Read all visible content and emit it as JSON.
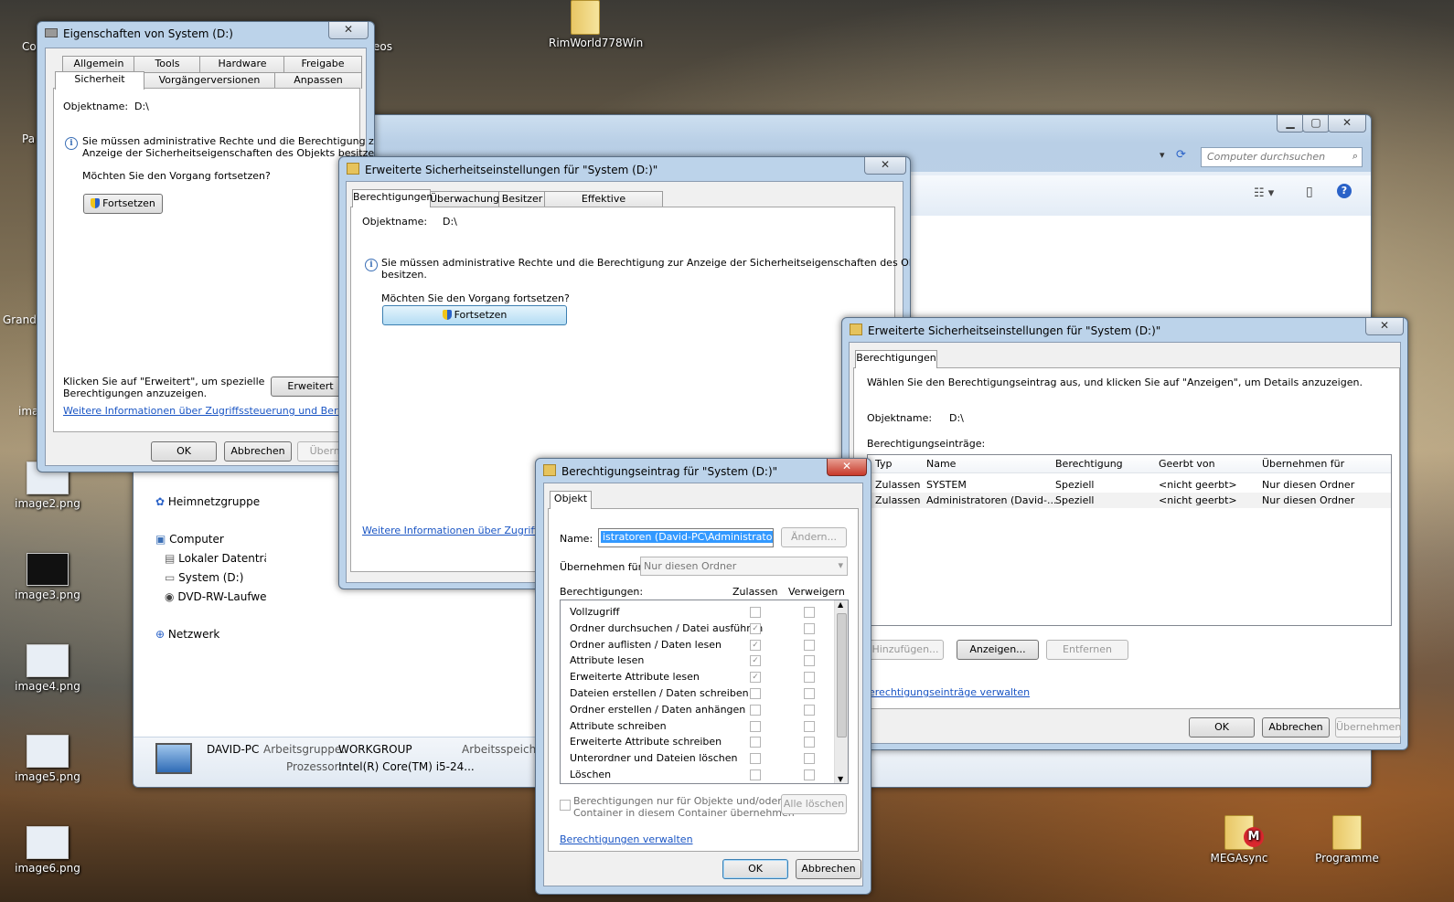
{
  "desktop": {
    "icons": [
      {
        "label": "RimWorld778Win",
        "kind": "folder"
      },
      {
        "label": "image2.png",
        "kind": "image"
      },
      {
        "label": "image3.png",
        "kind": "image"
      },
      {
        "label": "image4.png",
        "kind": "image"
      },
      {
        "label": "image5.png",
        "kind": "image"
      },
      {
        "label": "image6.png",
        "kind": "image"
      },
      {
        "label": "MEGAsync",
        "kind": "folder"
      },
      {
        "label": "Programme",
        "kind": "folder"
      }
    ],
    "partial_labels": [
      "Co",
      "Pa",
      "Grand",
      "ima",
      "eos"
    ]
  },
  "explorer": {
    "search_placeholder": "Computer durchsuchen",
    "nav": [
      "Heimnetzgruppe",
      "Computer",
      "Lokaler Datenträg",
      "System (D:)",
      "DVD-RW-Laufwe",
      "Netzwerk"
    ],
    "details": {
      "pc_name": "DAVID-PC",
      "workgroup_label": "Arbeitsgruppe:",
      "workgroup_value": "WORKGROUP",
      "memory_label": "Arbeitsspeicher",
      "cpu_label": "Prozessor:",
      "cpu_value": "Intel(R) Core(TM) i5-24..."
    }
  },
  "props_dialog": {
    "title": "Eigenschaften von System (D:)",
    "tabs_row1": [
      "Allgemein",
      "Tools",
      "Hardware",
      "Freigabe"
    ],
    "tabs_row2": [
      "Sicherheit",
      "Vorgängerversionen",
      "Anpassen"
    ],
    "object_label": "Objektname:",
    "object_value": "D:\\",
    "info_text_1": "Sie müssen administrative Rechte und die Berechtigung zur",
    "info_text_2": "Anzeige der Sicherheitseigenschaften des Objekts besitzen.",
    "continue_question": "Möchten Sie den Vorgang fortsetzen?",
    "continue_button": "Fortsetzen",
    "advanced_text_1": "Klicken Sie auf \"Erweitert\", um spezielle",
    "advanced_text_2": "Berechtigungen anzuzeigen.",
    "advanced_button": "Erweitert",
    "more_info_link": "Weitere Informationen über Zugriffssteuerung und Berechtigungen",
    "ok": "OK",
    "cancel": "Abbrechen",
    "apply": "Überneh"
  },
  "adv_dialog_1": {
    "title": "Erweiterte Sicherheitseinstellungen für \"System (D:)\"",
    "tabs": [
      "Berechtigungen",
      "Überwachung",
      "Besitzer",
      "Effektive Berechtigungen"
    ],
    "object_label": "Objektname:",
    "object_value": "D:\\",
    "info_text_1": "Sie müssen administrative Rechte und die Berechtigung zur Anzeige der Sicherheitseigenschaften des Objekts",
    "info_text_2": "besitzen.",
    "continue_question": "Möchten Sie den Vorgang fortsetzen?",
    "continue_button": "Fortsetzen",
    "more_info_link": "Weitere Informationen über Zugriffssteu"
  },
  "adv_dialog_2": {
    "title": "Erweiterte Sicherheitseinstellungen für \"System (D:)\"",
    "tab": "Berechtigungen",
    "instruction": "Wählen Sie den Berechtigungseintrag aus, und klicken Sie auf \"Anzeigen\", um Details anzuzeigen.",
    "object_label": "Objektname:",
    "object_value": "D:\\",
    "entries_label": "Berechtigungseinträge:",
    "columns": [
      "Typ",
      "Name",
      "Berechtigung",
      "Geerbt von",
      "Übernehmen für"
    ],
    "rows": [
      [
        "Zulassen",
        "SYSTEM",
        "Speziell",
        "<nicht geerbt>",
        "Nur diesen Ordner"
      ],
      [
        "Zulassen",
        "Administratoren (David-...",
        "Speziell",
        "<nicht geerbt>",
        "Nur diesen Ordner"
      ]
    ],
    "add_button": "Hinzufügen...",
    "view_button": "Anzeigen...",
    "remove_button": "Entfernen",
    "manage_link": "erechtigungseinträge verwalten",
    "ok": "OK",
    "cancel": "Abbrechen",
    "apply": "Übernehmen"
  },
  "entry_dialog": {
    "title": "Berechtigungseintrag für \"System (D:)\"",
    "tab": "Objekt",
    "name_label": "Name:",
    "name_value": "istratoren (David-PC\\Administratoren)",
    "change_button": "Ändern...",
    "apply_to_label": "Übernehmen für:",
    "apply_to_value": "Nur diesen Ordner",
    "perms_label": "Berechtigungen:",
    "allow_label": "Zulassen",
    "deny_label": "Verweigern",
    "permissions": [
      {
        "name": "Vollzugriff",
        "allow": false,
        "deny": false
      },
      {
        "name": "Ordner durchsuchen / Datei ausführen",
        "allow": true,
        "deny": false
      },
      {
        "name": "Ordner auflisten / Daten lesen",
        "allow": true,
        "deny": false
      },
      {
        "name": "Attribute lesen",
        "allow": true,
        "deny": false
      },
      {
        "name": "Erweiterte Attribute lesen",
        "allow": true,
        "deny": false
      },
      {
        "name": "Dateien erstellen / Daten schreiben",
        "allow": false,
        "deny": false
      },
      {
        "name": "Ordner erstellen / Daten anhängen",
        "allow": false,
        "deny": false
      },
      {
        "name": "Attribute schreiben",
        "allow": false,
        "deny": false
      },
      {
        "name": "Erweiterte Attribute schreiben",
        "allow": false,
        "deny": false
      },
      {
        "name": "Unterordner und Dateien löschen",
        "allow": false,
        "deny": false
      },
      {
        "name": "Löschen",
        "allow": false,
        "deny": false
      }
    ],
    "inherit_text_1": "Berechtigungen nur für Objekte und/oder",
    "inherit_text_2": "Container in diesem Container übernehmen",
    "clear_all_button": "Alle löschen",
    "manage_link": "Berechtigungen verwalten",
    "ok": "OK",
    "cancel": "Abbrechen"
  },
  "colors": {
    "accent": "#3c7fb1",
    "link": "#1a55c4",
    "title_glass": "#bcd3ea",
    "close_red": "#c7392a"
  }
}
